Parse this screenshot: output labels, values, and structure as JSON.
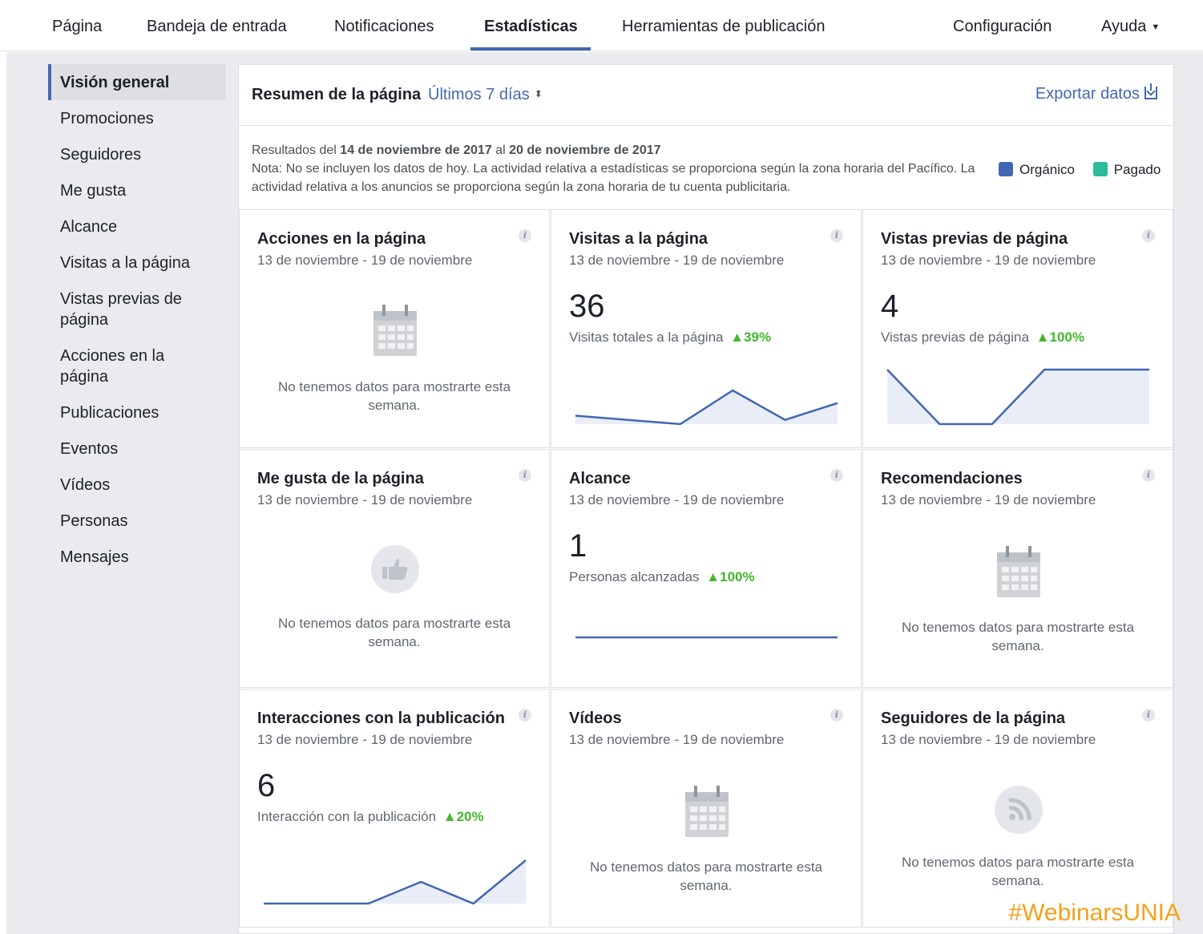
{
  "topnav": {
    "tabs": [
      "Página",
      "Bandeja de entrada",
      "Notificaciones",
      "Estadísticas",
      "Herramientas de publicación"
    ],
    "settings": "Configuración",
    "help": "Ayuda"
  },
  "sidebar": {
    "items": [
      "Visión general",
      "Promociones",
      "Seguidores",
      "Me gusta",
      "Alcance",
      "Visitas a la página",
      "Vistas previas de página",
      "Acciones en la página",
      "Publicaciones",
      "Eventos",
      "Vídeos",
      "Personas",
      "Mensajes"
    ]
  },
  "summary": {
    "title": "Resumen de la página",
    "range": "Últimos 7 días",
    "export": "Exportar datos",
    "results_prefix": "Resultados del",
    "results_from": "14 de noviembre de 2017",
    "results_mid": "al",
    "results_to": "20 de noviembre de 2017",
    "note": "Nota: No se incluyen los datos de hoy. La actividad relativa a estadísticas se proporciona según la zona horaria del Pacífico. La actividad relativa a los anuncios se proporciona según la zona horaria de tu cuenta publicitaria.",
    "legend": [
      {
        "label": "Orgánico",
        "color": "#4267b2"
      },
      {
        "label": "Pagado",
        "color": "#2bbc98"
      }
    ]
  },
  "tiles": [
    {
      "title": "Acciones en la página",
      "date": "13 de noviembre - 19 de noviembre",
      "nodata": "No tenemos datos para mostrarte esta semana.",
      "icon": "calendar-icon"
    },
    {
      "title": "Visitas a la página",
      "date": "13 de noviembre - 19 de noviembre",
      "value": "36",
      "metric": "Visitas totales a la página",
      "delta": "39%",
      "spark": [
        3,
        2,
        1,
        9,
        2,
        6
      ]
    },
    {
      "title": "Vistas previas de página",
      "date": "13 de noviembre - 19 de noviembre",
      "value": "4",
      "metric": "Vistas previas de página",
      "delta": "100%",
      "spark": [
        1,
        0,
        0,
        1,
        1,
        1
      ]
    },
    {
      "title": "Me gusta de la página",
      "date": "13 de noviembre - 19 de noviembre",
      "nodata": "No tenemos datos para mostrarte esta semana.",
      "icon": "thumbs-up-icon"
    },
    {
      "title": "Alcance",
      "date": "13 de noviembre - 19 de noviembre",
      "value": "1",
      "metric": "Personas alcanzadas",
      "delta": "100%",
      "spark": [
        0,
        0,
        0,
        0,
        0,
        0
      ]
    },
    {
      "title": "Recomendaciones",
      "date": "13 de noviembre - 19 de noviembre",
      "nodata": "No tenemos datos para mostrarte esta semana.",
      "icon": "calendar-icon"
    },
    {
      "title": "Interacciones con la publicación",
      "date": "13 de noviembre - 19 de noviembre",
      "value": "6",
      "metric": "Interacción con la publicación",
      "delta": "20%",
      "spark": [
        0,
        0,
        0,
        2,
        0,
        4
      ]
    },
    {
      "title": "Vídeos",
      "date": "13 de noviembre - 19 de noviembre",
      "nodata": "No tenemos datos para mostrarte esta semana.",
      "icon": "calendar-icon"
    },
    {
      "title": "Seguidores de la página",
      "date": "13 de noviembre - 19 de noviembre",
      "nodata": "No tenemos datos para mostrarte esta semana.",
      "icon": "rss-icon"
    }
  ],
  "watermark": "#WebinarsUNIA"
}
